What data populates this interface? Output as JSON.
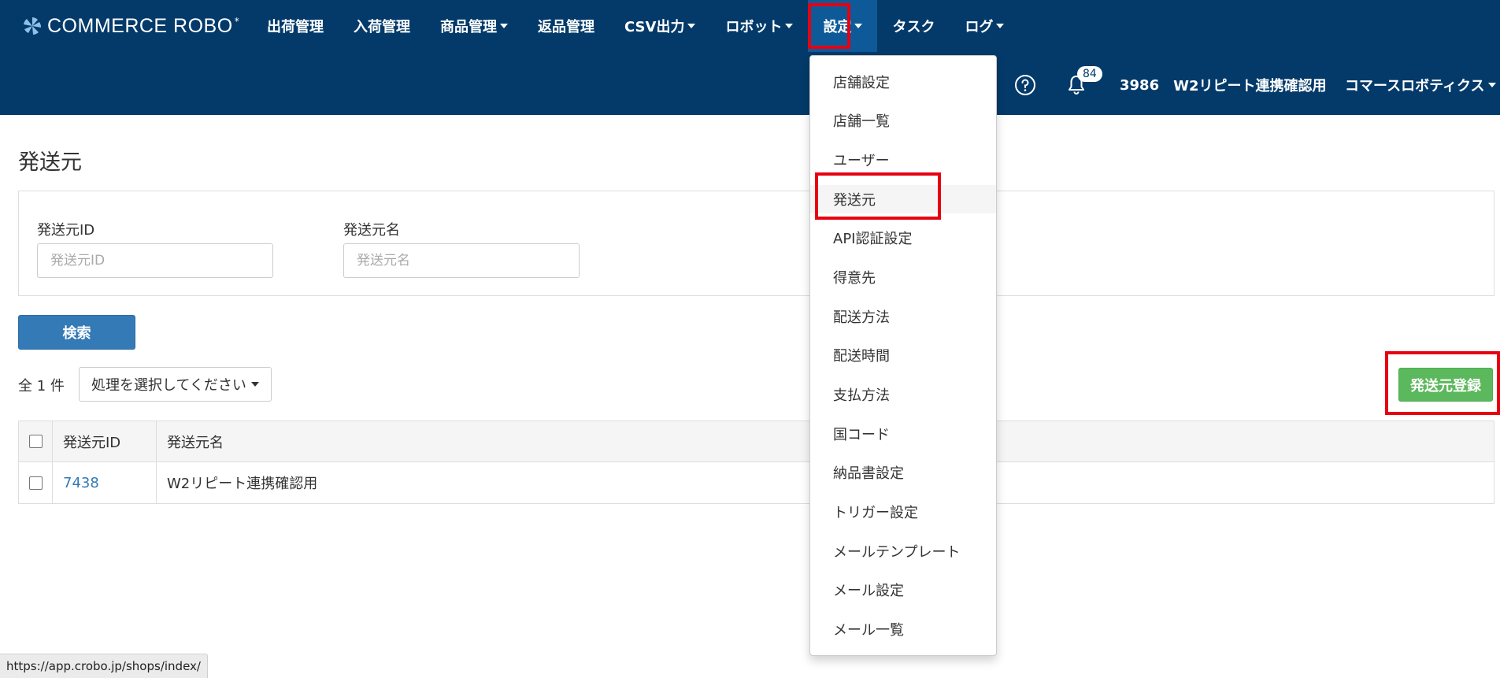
{
  "brand": {
    "name": "COMMERCE ROBO",
    "mark": "*",
    "icon": "logo-pinwheel-icon"
  },
  "nav": {
    "items": [
      {
        "label": "出荷管理",
        "dropdown": false
      },
      {
        "label": "入荷管理",
        "dropdown": false
      },
      {
        "label": "商品管理",
        "dropdown": true
      },
      {
        "label": "返品管理",
        "dropdown": false
      },
      {
        "label": "CSV出力",
        "dropdown": true
      },
      {
        "label": "ロボット",
        "dropdown": true
      },
      {
        "label": "設定",
        "dropdown": true,
        "active": true
      },
      {
        "label": "タスク",
        "dropdown": false
      },
      {
        "label": "ログ",
        "dropdown": true
      }
    ]
  },
  "header": {
    "help_icon": "question-circle-icon",
    "bell_icon": "bell-icon",
    "notification_count": "84",
    "store_id": "3986",
    "store_name": "W2リピート連携確認用",
    "company": "コマースロボティクス"
  },
  "settings_menu": {
    "items": [
      "店舗設定",
      "店舗一覧",
      "ユーザー",
      "発送元",
      "API認証設定",
      "得意先",
      "配送方法",
      "配送時間",
      "支払方法",
      "国コード",
      "納品書設定",
      "トリガー設定",
      "メールテンプレート",
      "メール設定",
      "メール一覧"
    ],
    "hovered": "発送元"
  },
  "page": {
    "title": "発送元"
  },
  "search": {
    "id_label": "発送元ID",
    "id_placeholder": "発送元ID",
    "id_value": "",
    "name_label": "発送元名",
    "name_placeholder": "発送元名",
    "name_value": "",
    "button": "検索"
  },
  "list": {
    "count_text": "全 1 件",
    "action_select": "処理を選択してください",
    "register_button": "発送元登録",
    "columns": [
      "発送元ID",
      "発送元名"
    ],
    "rows": [
      {
        "id": "7438",
        "name": "W2リピート連携確認用"
      }
    ]
  },
  "status_url": "https://app.crobo.jp/shops/index/",
  "colors": {
    "header_bg": "#033a6a",
    "active_nav": "#0e5a99",
    "primary": "#337ab7",
    "success": "#5cb85c",
    "highlight": "#e60012"
  }
}
